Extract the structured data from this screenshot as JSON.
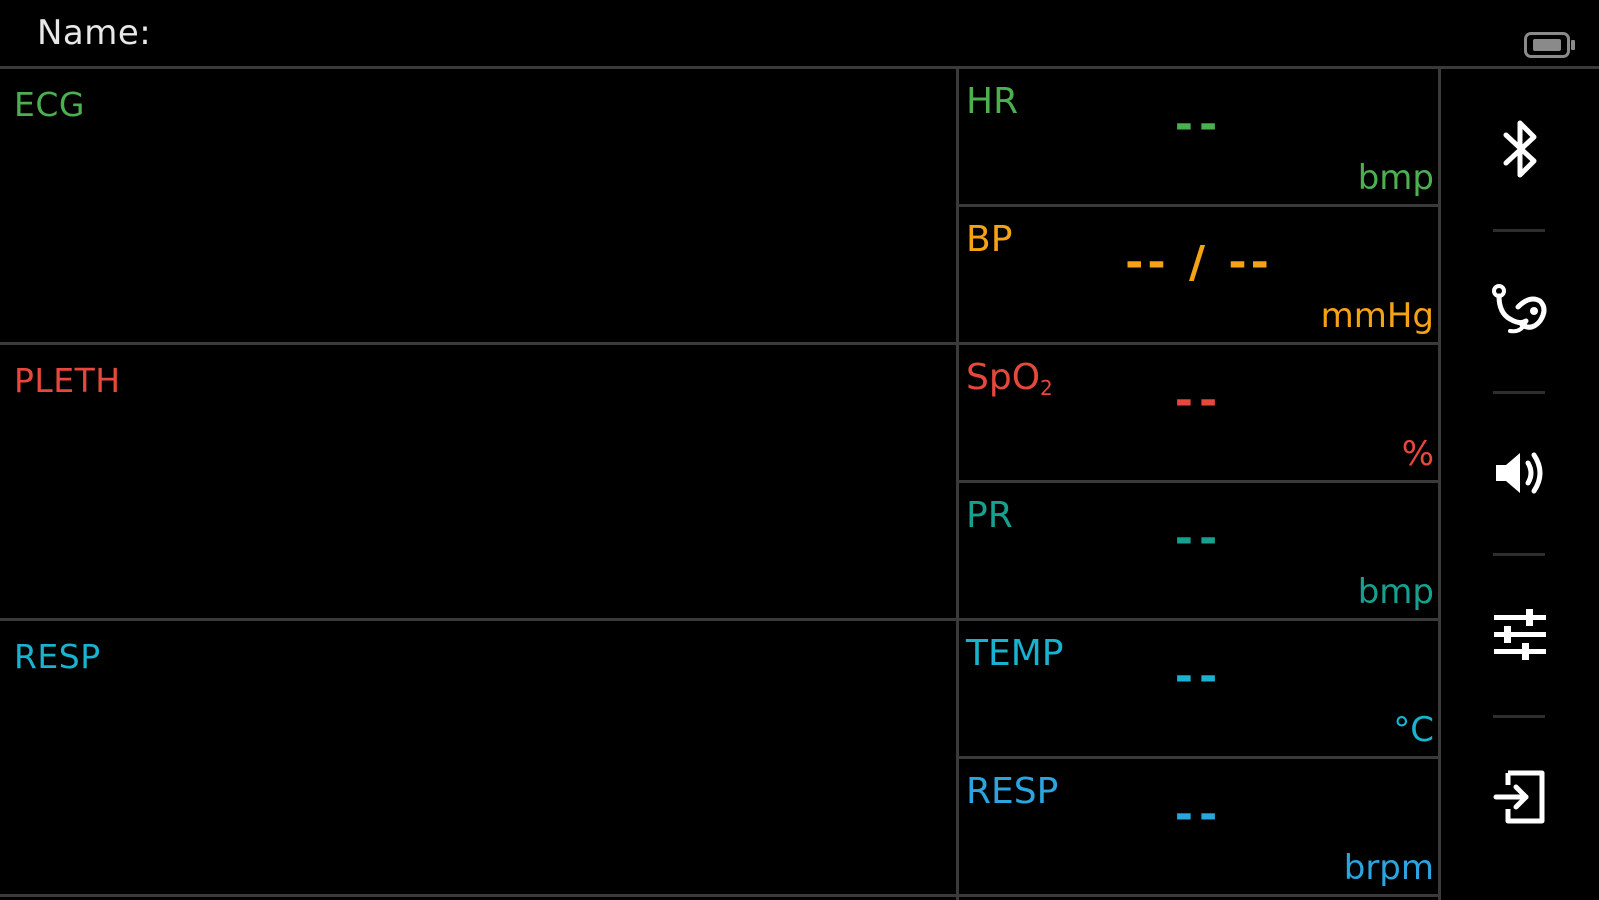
{
  "header": {
    "name_label": "Name:",
    "battery_icon": "battery-icon"
  },
  "waveforms": [
    {
      "label": "ECG",
      "color": "#4caf50"
    },
    {
      "label": "PLETH",
      "color": "#e8473b"
    },
    {
      "label": "RESP",
      "color": "#18b3cf"
    }
  ],
  "params": {
    "hr": {
      "label": "HR",
      "value": "--",
      "unit": "bmp",
      "color": "#4caf50"
    },
    "bp": {
      "label": "BP",
      "value": "-- / --",
      "unit": "mmHg",
      "color": "#f5a314"
    },
    "spo2": {
      "label_main": "SpO",
      "label_sub": "2",
      "value": "--",
      "unit": "%",
      "color": "#e8473b"
    },
    "pr": {
      "label": "PR",
      "value": "--",
      "unit": "bmp",
      "color": "#16a08f"
    },
    "temp": {
      "label": "TEMP",
      "value": "--",
      "unit": "°C",
      "color": "#18b3cf"
    },
    "resp": {
      "label": "RESP",
      "value": "--",
      "unit": "brpm",
      "color": "#2aa5e0"
    }
  },
  "sidebar": {
    "buttons": [
      {
        "icon": "bluetooth-icon"
      },
      {
        "icon": "stethoscope-icon"
      },
      {
        "icon": "speaker-icon"
      },
      {
        "icon": "sliders-icon"
      },
      {
        "icon": "login-icon"
      }
    ]
  }
}
